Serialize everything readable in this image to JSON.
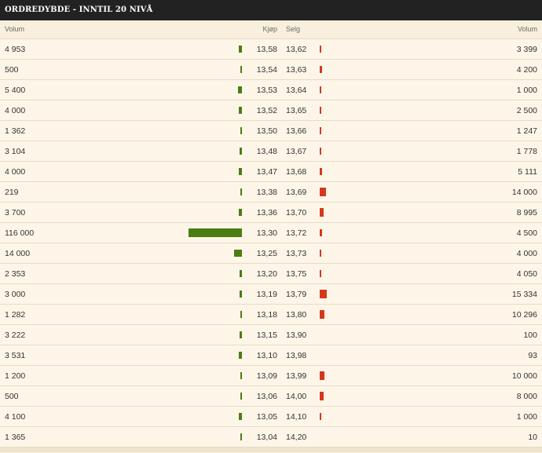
{
  "header": {
    "title": "ORDREDYBDE - INNTIL 20 NIVÅ"
  },
  "columns": {
    "buy_volume": "Volum",
    "buy_price": "Kjøp",
    "sell_price": "Selg",
    "sell_volume": "Volum"
  },
  "colors": {
    "buy": "#4a7d12",
    "sell": "#d6371c",
    "header_bg": "#222222",
    "row_bg": "#fdf6e8"
  },
  "depth_scale_max": 116000,
  "rows": [
    {
      "buy_vol": "4 953",
      "buy_vol_num": 4953,
      "buy_price": "13,58",
      "sell_price": "13,62",
      "sell_vol": "3 399",
      "sell_vol_num": 3399
    },
    {
      "buy_vol": "500",
      "buy_vol_num": 500,
      "buy_price": "13,54",
      "sell_price": "13,63",
      "sell_vol": "4 200",
      "sell_vol_num": 4200
    },
    {
      "buy_vol": "5 400",
      "buy_vol_num": 5400,
      "buy_price": "13,53",
      "sell_price": "13,64",
      "sell_vol": "1 000",
      "sell_vol_num": 1000
    },
    {
      "buy_vol": "4 000",
      "buy_vol_num": 4000,
      "buy_price": "13,52",
      "sell_price": "13,65",
      "sell_vol": "2 500",
      "sell_vol_num": 2500
    },
    {
      "buy_vol": "1 362",
      "buy_vol_num": 1362,
      "buy_price": "13,50",
      "sell_price": "13,66",
      "sell_vol": "1 247",
      "sell_vol_num": 1247
    },
    {
      "buy_vol": "3 104",
      "buy_vol_num": 3104,
      "buy_price": "13,48",
      "sell_price": "13,67",
      "sell_vol": "1 778",
      "sell_vol_num": 1778
    },
    {
      "buy_vol": "4 000",
      "buy_vol_num": 4000,
      "buy_price": "13,47",
      "sell_price": "13,68",
      "sell_vol": "5 111",
      "sell_vol_num": 5111
    },
    {
      "buy_vol": "219",
      "buy_vol_num": 219,
      "buy_price": "13,38",
      "sell_price": "13,69",
      "sell_vol": "14 000",
      "sell_vol_num": 14000
    },
    {
      "buy_vol": "3 700",
      "buy_vol_num": 3700,
      "buy_price": "13,36",
      "sell_price": "13,70",
      "sell_vol": "8 995",
      "sell_vol_num": 8995
    },
    {
      "buy_vol": "116 000",
      "buy_vol_num": 116000,
      "buy_price": "13,30",
      "sell_price": "13,72",
      "sell_vol": "4 500",
      "sell_vol_num": 4500
    },
    {
      "buy_vol": "14 000",
      "buy_vol_num": 14000,
      "buy_price": "13,25",
      "sell_price": "13,73",
      "sell_vol": "4 000",
      "sell_vol_num": 4000
    },
    {
      "buy_vol": "2 353",
      "buy_vol_num": 2353,
      "buy_price": "13,20",
      "sell_price": "13,75",
      "sell_vol": "4 050",
      "sell_vol_num": 4050
    },
    {
      "buy_vol": "3 000",
      "buy_vol_num": 3000,
      "buy_price": "13,19",
      "sell_price": "13,79",
      "sell_vol": "15 334",
      "sell_vol_num": 15334
    },
    {
      "buy_vol": "1 282",
      "buy_vol_num": 1282,
      "buy_price": "13,18",
      "sell_price": "13,80",
      "sell_vol": "10 296",
      "sell_vol_num": 10296
    },
    {
      "buy_vol": "3 222",
      "buy_vol_num": 3222,
      "buy_price": "13,15",
      "sell_price": "13,90",
      "sell_vol": "100",
      "sell_vol_num": 100
    },
    {
      "buy_vol": "3 531",
      "buy_vol_num": 3531,
      "buy_price": "13,10",
      "sell_price": "13,98",
      "sell_vol": "93",
      "sell_vol_num": 93
    },
    {
      "buy_vol": "1 200",
      "buy_vol_num": 1200,
      "buy_price": "13,09",
      "sell_price": "13,99",
      "sell_vol": "10 000",
      "sell_vol_num": 10000
    },
    {
      "buy_vol": "500",
      "buy_vol_num": 500,
      "buy_price": "13,06",
      "sell_price": "14,00",
      "sell_vol": "8 000",
      "sell_vol_num": 8000
    },
    {
      "buy_vol": "4 100",
      "buy_vol_num": 4100,
      "buy_price": "13,05",
      "sell_price": "14,10",
      "sell_vol": "1 000",
      "sell_vol_num": 1000
    },
    {
      "buy_vol": "1 365",
      "buy_vol_num": 1365,
      "buy_price": "13,04",
      "sell_price": "14,20",
      "sell_vol": "10",
      "sell_vol_num": 10
    }
  ]
}
